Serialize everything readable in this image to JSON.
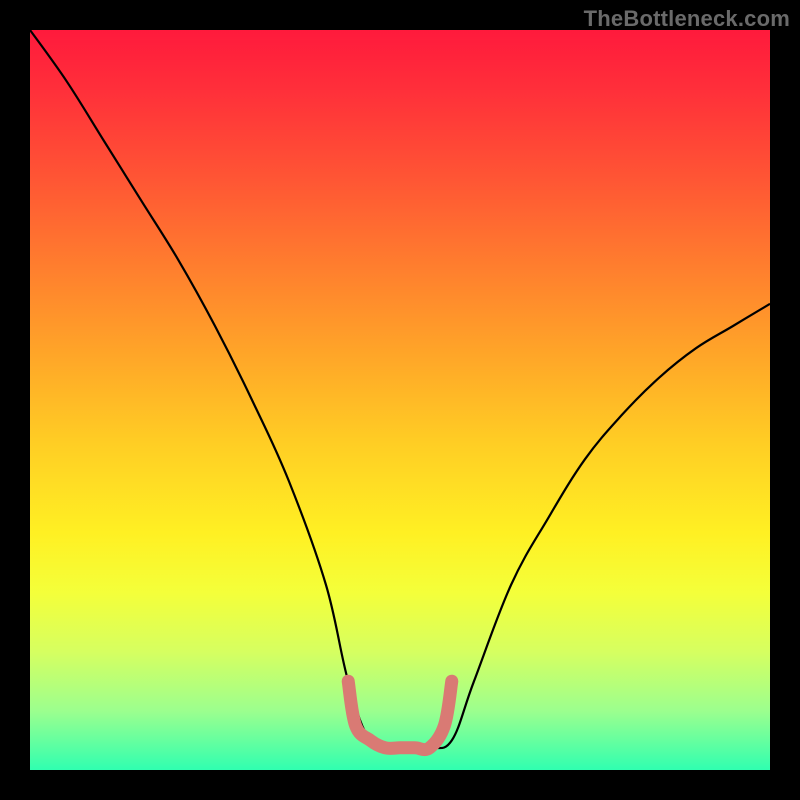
{
  "watermark": "TheBottleneck.com",
  "chart_data": {
    "type": "line",
    "title": "",
    "xlabel": "",
    "ylabel": "",
    "xlim": [
      0,
      100
    ],
    "ylim": [
      0,
      100
    ],
    "series": [
      {
        "name": "bottleneck-curve",
        "color": "#000000",
        "x": [
          0,
          5,
          10,
          15,
          20,
          25,
          30,
          35,
          40,
          43,
          46,
          50,
          54,
          57,
          60,
          65,
          70,
          75,
          80,
          85,
          90,
          95,
          100
        ],
        "values": [
          100,
          93,
          85,
          77,
          69,
          60,
          50,
          39,
          25,
          12,
          4,
          3,
          3,
          4,
          12,
          25,
          34,
          42,
          48,
          53,
          57,
          60,
          63
        ]
      },
      {
        "name": "optimal-band",
        "color": "#d97a74",
        "x": [
          43,
          44,
          46,
          48,
          50,
          52,
          54,
          56,
          57
        ],
        "values": [
          12,
          6,
          4,
          3,
          3,
          3,
          3,
          6,
          12
        ]
      }
    ],
    "annotations": []
  }
}
